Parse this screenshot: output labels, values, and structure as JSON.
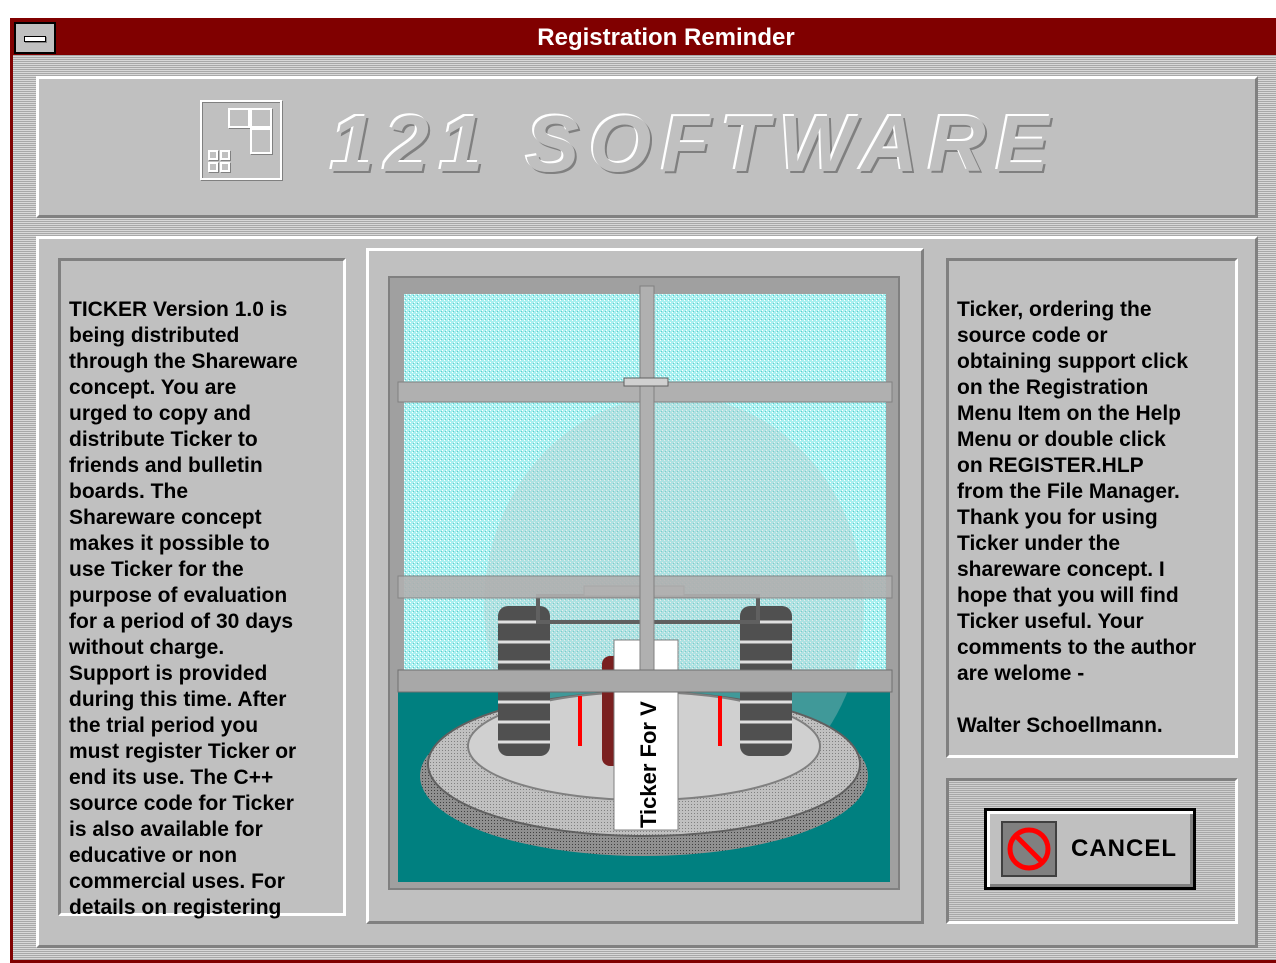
{
  "window": {
    "title": "Registration Reminder"
  },
  "banner": {
    "logo_text": "121 SOFTWARE"
  },
  "left_text": "TICKER Version 1.0 is\nbeing distributed\nthrough the Shareware\nconcept.  You are\nurged to copy and\ndistribute Ticker to\nfriends and bulletin\nboards.  The\nShareware concept\nmakes it possible to\nuse Ticker for the\npurpose of evaluation\nfor a period of 30 days\nwithout charge.\nSupport is provided\nduring this time.  After\nthe trial period you\nmust register Ticker or\nend its use.  The C++\nsource code for Ticker\nis also available for\neducative or non\ncommercial uses.  For\ndetails on registering",
  "right_text": "Ticker, ordering the\nsource code or\nobtaining support click\non the Registration\nMenu Item on the Help\nMenu or double click\non REGISTER.HLP\nfrom the File Manager.\nThank you for using\nTicker under the\nshareware concept.  I\nhope that you will find\nTicker useful.  Your\ncomments to the author\nare welome -\n\nWalter Schoellmann.",
  "picture": {
    "ticker_label": "Ticker For V"
  },
  "cancel_button": {
    "label": "CANCEL",
    "icon": "no-entry-icon"
  },
  "colors": {
    "titlebar": "#800000",
    "face": "#c0c0c0",
    "teal": "#008080",
    "cyan": "#a8f0f0"
  }
}
